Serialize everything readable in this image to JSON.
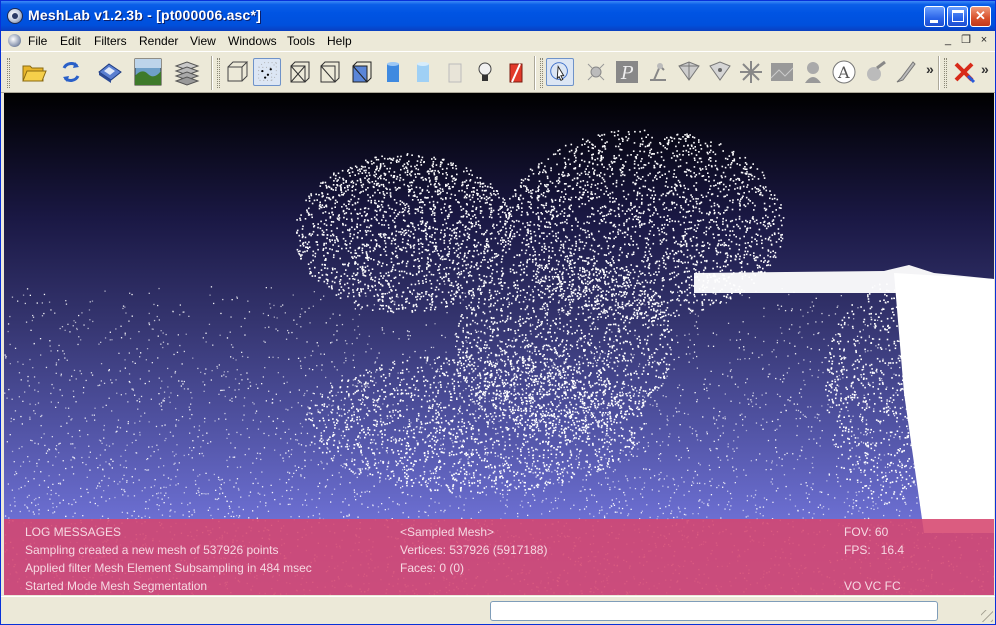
{
  "window": {
    "title": "MeshLab v1.2.3b - [pt000006.asc*]",
    "minimize_icon": "minimize-icon",
    "maximize_icon": "maximize-icon",
    "close_label": "✕"
  },
  "menu": {
    "items": [
      "File",
      "Edit",
      "Filters",
      "Render",
      "View",
      "Windows",
      "Tools",
      "Help"
    ],
    "mdi": {
      "minimize": "_",
      "restore": "❐",
      "close": "×"
    }
  },
  "toolbar": {
    "groups": [
      [
        "open-folder-icon",
        "reload-icon",
        "save-icon",
        "snapshot-icon",
        "layers-icon"
      ],
      [
        "bounding-box-icon",
        "points-icon",
        "wireframe-icon",
        "hidden-lines-icon",
        "flat-lines-icon",
        "flat-shading-icon",
        "smooth-shading-icon",
        "texture-icon",
        "light-icon",
        "color-icon"
      ],
      [
        "manipulator-icon",
        "paint-icon",
        "pick-points-icon",
        "measure-icon",
        "select-faces-icon",
        "select-vertices-icon",
        "align-icon",
        "texture-param-icon",
        "reference-icon",
        "annotation-icon",
        "segmentation-icon",
        "brush-icon"
      ],
      [
        "delete-icon"
      ]
    ],
    "overflow": "»"
  },
  "viewport": {
    "log_title": "LOG MESSAGES",
    "log_lines": [
      "Sampling created a new mesh of 537926 points",
      "Applied filter Mesh Element Subsampling in 484 msec",
      "Started Mode Mesh Segmentation"
    ],
    "mesh_name": "<Sampled Mesh>",
    "vertices": "Vertices: 537926 (5917188)",
    "faces": "Faces: 0 (0)",
    "fov": "FOV: 60",
    "fps": "FPS:   16.4",
    "flags": "VO VC FC"
  },
  "statusbar": {
    "field_value": ""
  },
  "colors": {
    "title_bar": "#0054e3",
    "background_top": "#000000",
    "background_bottom": "#7a7ee0",
    "log_overlay": "#d6466e",
    "points": "#ffffff"
  }
}
